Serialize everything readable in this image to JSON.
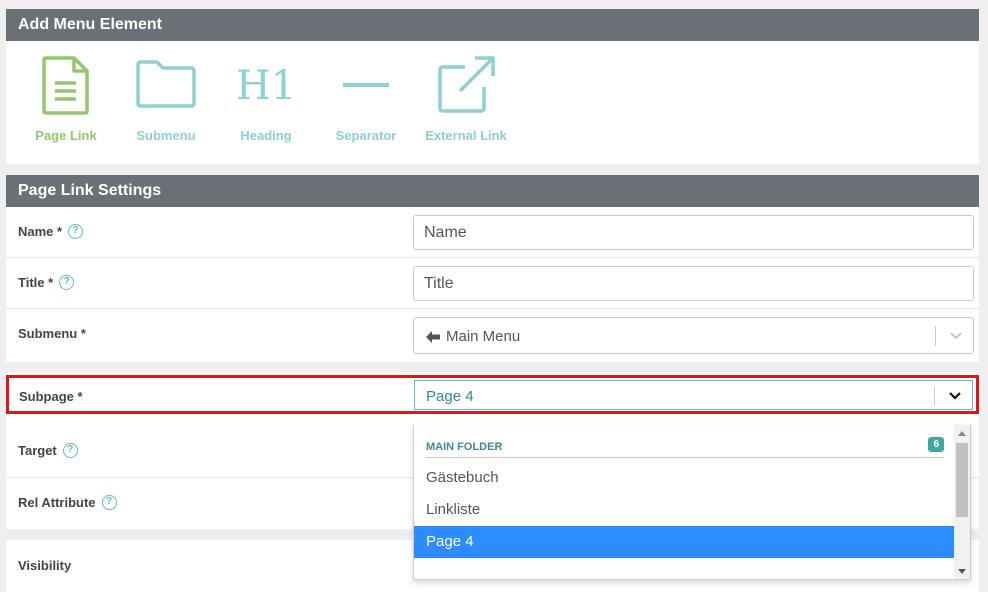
{
  "add_menu": {
    "title": "Add Menu Element",
    "types": [
      {
        "label": "Page Link",
        "icon": "page-icon"
      },
      {
        "label": "Submenu",
        "icon": "folder-icon"
      },
      {
        "label": "Heading",
        "icon": "heading-h1-icon"
      },
      {
        "label": "Separator",
        "icon": "separator-line-icon"
      },
      {
        "label": "External Link",
        "icon": "external-link-icon"
      }
    ]
  },
  "settings": {
    "title": "Page Link Settings",
    "name": {
      "label": "Name *",
      "placeholder": "Name"
    },
    "title_field": {
      "label": "Title *",
      "placeholder": "Title"
    },
    "submenu": {
      "label": "Submenu *",
      "value": "Main Menu"
    },
    "subpage": {
      "label": "Subpage *",
      "value": "Page 4"
    },
    "target": {
      "label": "Target"
    },
    "rel": {
      "label": "Rel Attribute"
    },
    "visibility": {
      "label": "Visibility"
    }
  },
  "dropdown": {
    "group": "MAIN FOLDER",
    "count": "6",
    "options": [
      "Gästebuch",
      "Linkliste",
      "Page 4"
    ]
  },
  "colors": {
    "header": "#6b7077",
    "active_type": "#93c76f",
    "type": "#8fd0d0",
    "highlight": "#e0141b",
    "selected_option": "#2d8cff"
  }
}
